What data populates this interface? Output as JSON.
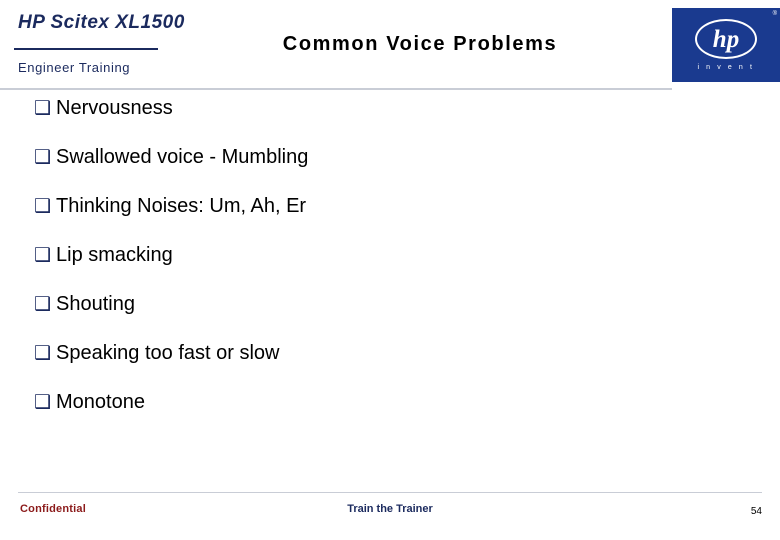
{
  "header": {
    "brand_title": "HP Scitex XL1500",
    "brand_subtitle": "Engineer Training",
    "slide_title": "Common Voice Problems",
    "logo": {
      "letters": "hp",
      "tagline": "i n v e n t",
      "registered_mark": "®",
      "background_color": "#1a3a8f"
    },
    "accent_color": "#1b2a5e"
  },
  "bullets": {
    "marker": "❯",
    "marker_glyph": "❑",
    "items": [
      {
        "text": "Nervousness"
      },
      {
        "text": "Swallowed voice - Mumbling"
      },
      {
        "text": "Thinking Noises: Um, Ah, Er"
      },
      {
        "text": "Lip smacking"
      },
      {
        "text": "Shouting"
      },
      {
        "text": "Speaking too fast or slow"
      },
      {
        "text": "Monotone"
      }
    ]
  },
  "footer": {
    "left": "Confidential",
    "center": "Train the Trainer",
    "page_number": "54",
    "left_color": "#8b1a1a",
    "center_color": "#1b2a5e"
  }
}
